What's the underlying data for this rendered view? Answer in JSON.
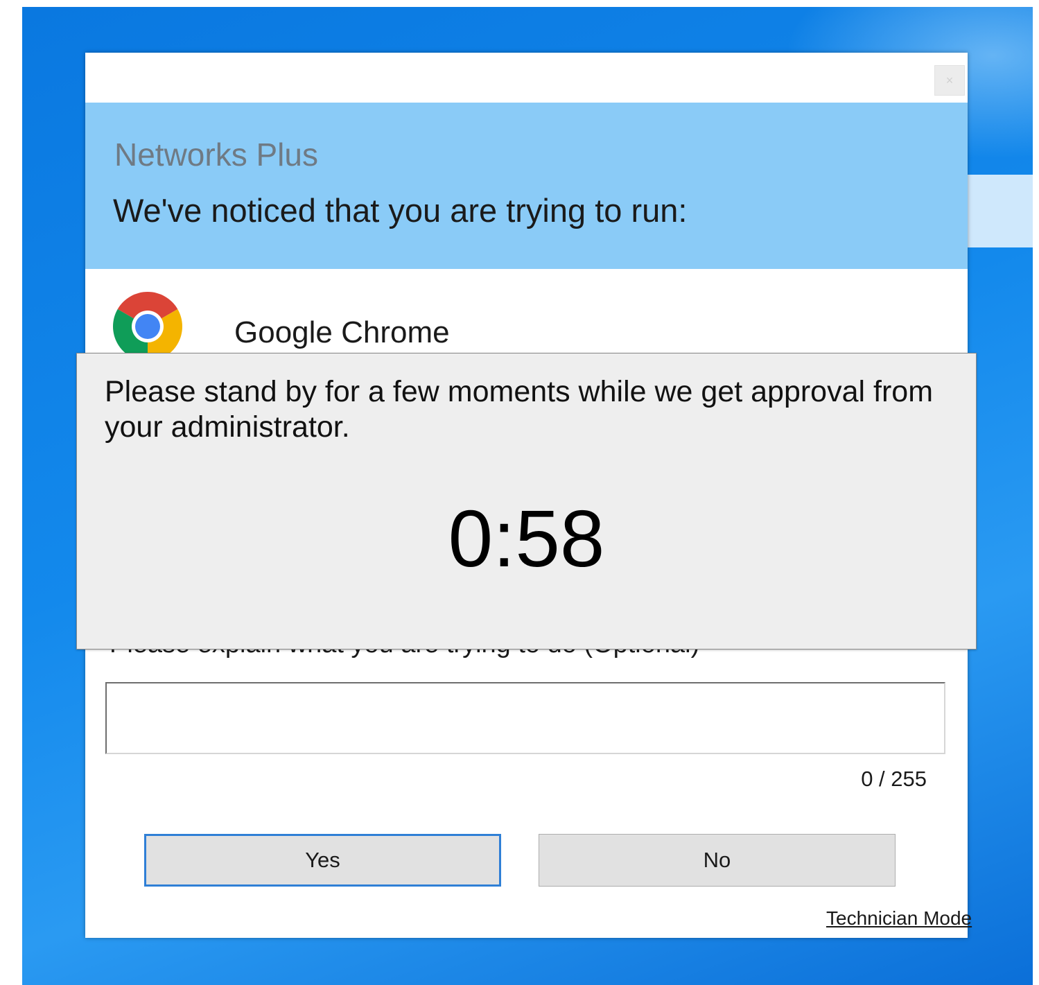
{
  "dialog": {
    "brand": "Networks Plus",
    "notice": "We've noticed that you are trying to run:",
    "app": {
      "name": "Google Chrome",
      "icon": "chrome-icon"
    },
    "close_label": "×",
    "explain_label": "Please explain what you are trying to do (Optional)",
    "explain_value": "",
    "char_counter": "0 / 255",
    "yes_label": "Yes",
    "no_label": "No",
    "technician_link": "Technician Mode"
  },
  "overlay": {
    "message": "Please stand by for a few moments while we get approval from your administrator.",
    "countdown": "0:58"
  },
  "colors": {
    "desktop": "#1389ec",
    "header": "#8acbf7",
    "brand_text": "#6f7a84",
    "overlay": "#eeeeee",
    "focus_border": "#2f7fd6"
  }
}
